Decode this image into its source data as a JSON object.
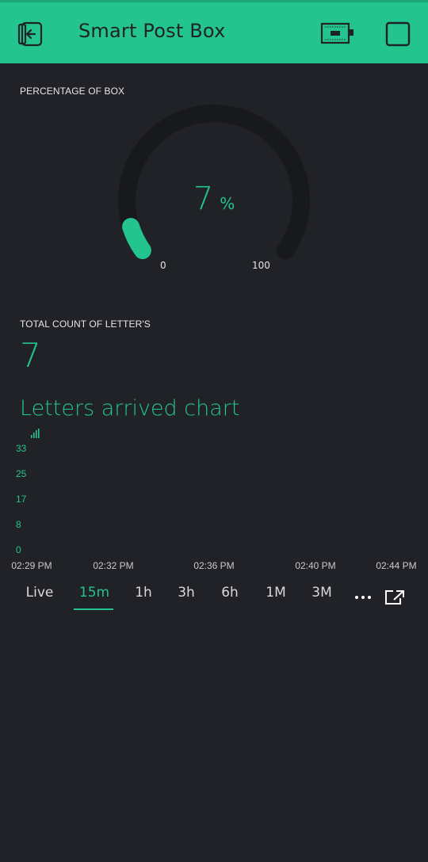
{
  "header": {
    "title": "Smart Post Box",
    "icons": [
      "back-icon",
      "device-icon",
      "square-icon"
    ]
  },
  "gauge": {
    "label": "PERCENTAGE OF BOX",
    "value": "7",
    "value_number": 7,
    "unit": "%",
    "min": "0",
    "max": "100"
  },
  "counter": {
    "label": "TOTAL COUNT OF LETTER'S",
    "value": "7"
  },
  "chart": {
    "title": "Letters arrived chart"
  },
  "chart_data": {
    "type": "line",
    "title": "Letters arrived chart",
    "y_ticks": [
      "33",
      "25",
      "17",
      "8",
      "0"
    ],
    "x_ticks": [
      "02:29 PM",
      "02:32 PM",
      "02:36 PM",
      "02:40 PM",
      "02:44 PM"
    ],
    "ylim": [
      0,
      33
    ],
    "series": [],
    "grid": false
  },
  "tabs": {
    "items": [
      "Live",
      "15m",
      "1h",
      "3h",
      "6h",
      "1M",
      "3M"
    ],
    "active": "15m"
  },
  "colors": {
    "accent": "#23c48e",
    "background": "#212227",
    "gauge_track": "#18191c"
  }
}
